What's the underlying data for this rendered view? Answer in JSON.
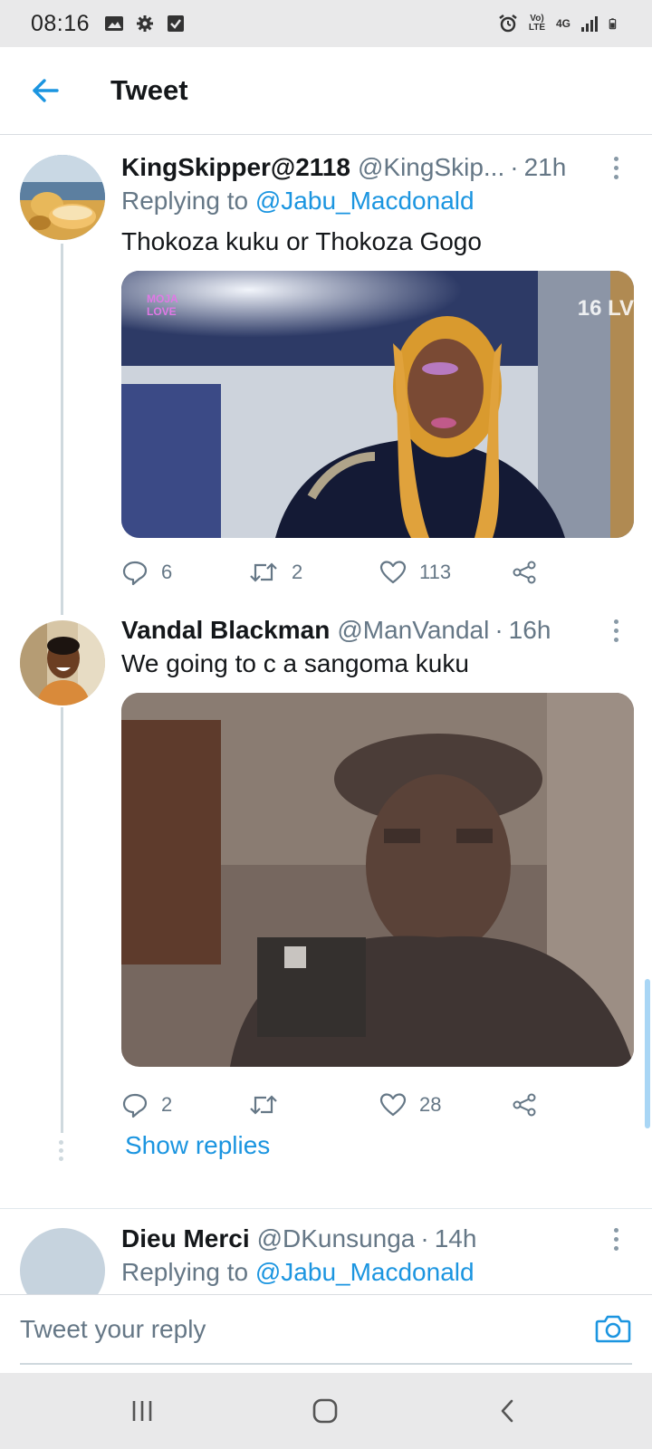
{
  "status_bar": {
    "time": "08:16",
    "network_volte": "Vo) LTE",
    "network_type": "4G"
  },
  "header": {
    "title": "Tweet"
  },
  "tweets": [
    {
      "name": "KingSkipper@2118",
      "handle": "@KingSkip...",
      "dot": "·",
      "time": "21h",
      "replying_prefix": "Replying to ",
      "replying_to": "@Jabu_Macdonald",
      "text": "Thokoza kuku or Thokoza Gogo",
      "media_overlay_left": "MOJA LOVE",
      "media_overlay_right": "16 LV",
      "replies": "6",
      "retweets": "2",
      "likes": "113"
    },
    {
      "name": "Vandal Blackman",
      "handle": "@ManVandal",
      "dot": "·",
      "time": "16h",
      "text": "We going to c a sangoma kuku",
      "replies": "2",
      "retweets": "",
      "likes": "28",
      "show_replies": "Show replies"
    },
    {
      "name": "Dieu Merci",
      "handle": "@DKunsunga",
      "dot": "·",
      "time": "14h",
      "replying_prefix": "Replying to ",
      "replying_to": "@Jabu_Macdonald"
    }
  ],
  "reply_bar": {
    "placeholder": "Tweet your reply"
  },
  "colors": {
    "accent": "#1b95e0",
    "secondary_text": "#657786",
    "primary_text": "#14171a"
  }
}
